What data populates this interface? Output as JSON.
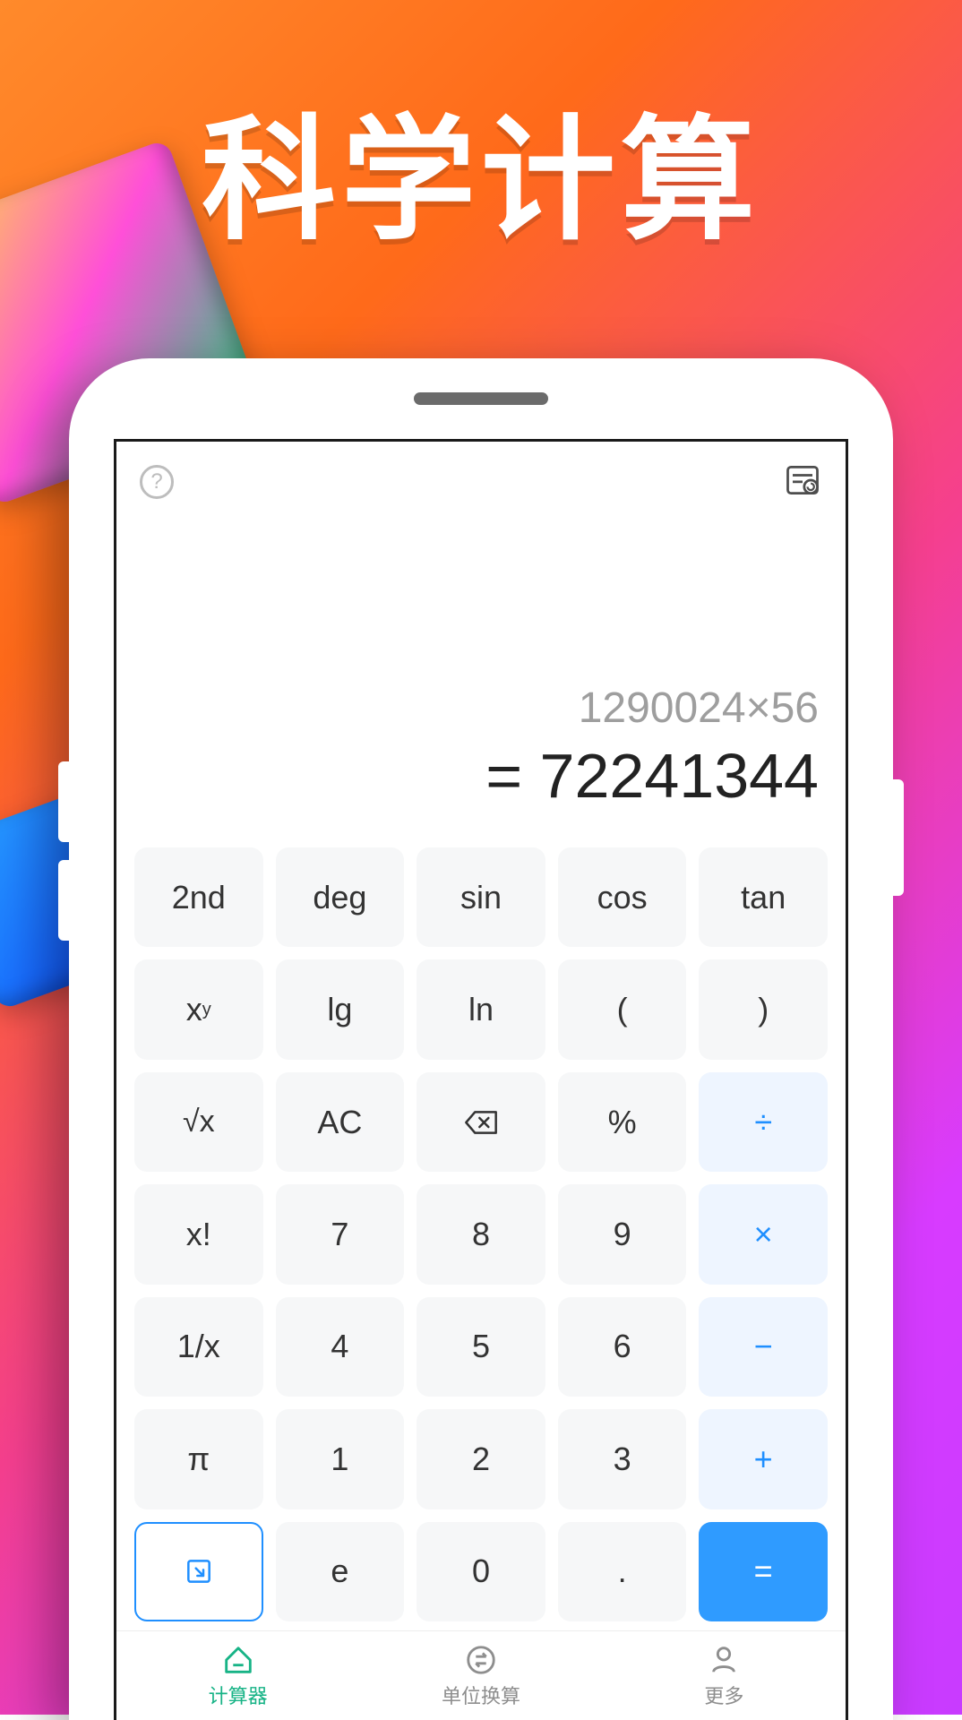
{
  "hero_title": "科学计算",
  "display": {
    "expression": "1290024×56",
    "result": "= 72241344"
  },
  "keys": {
    "r0": [
      "2nd",
      "deg",
      "sin",
      "cos",
      "tan"
    ],
    "r1_xy": "x",
    "r1_xy_sup": "y",
    "r1": [
      "lg",
      "ln",
      "(",
      ")"
    ],
    "r2_sqrt": "√x",
    "r2_ac": "AC",
    "r2_pct": "%",
    "r2_div": "÷",
    "r3_fact": "x!",
    "r3": [
      "7",
      "8",
      "9"
    ],
    "r3_mul": "×",
    "r4_inv": "1/x",
    "r4": [
      "4",
      "5",
      "6"
    ],
    "r4_sub": "−",
    "r5_pi": "π",
    "r5": [
      "1",
      "2",
      "3"
    ],
    "r5_add": "+",
    "r6_e": "e",
    "r6_0": "0",
    "r6_dot": ".",
    "r6_eq": "="
  },
  "tabs": {
    "calc": "计算器",
    "unit": "单位换算",
    "more": "更多"
  }
}
